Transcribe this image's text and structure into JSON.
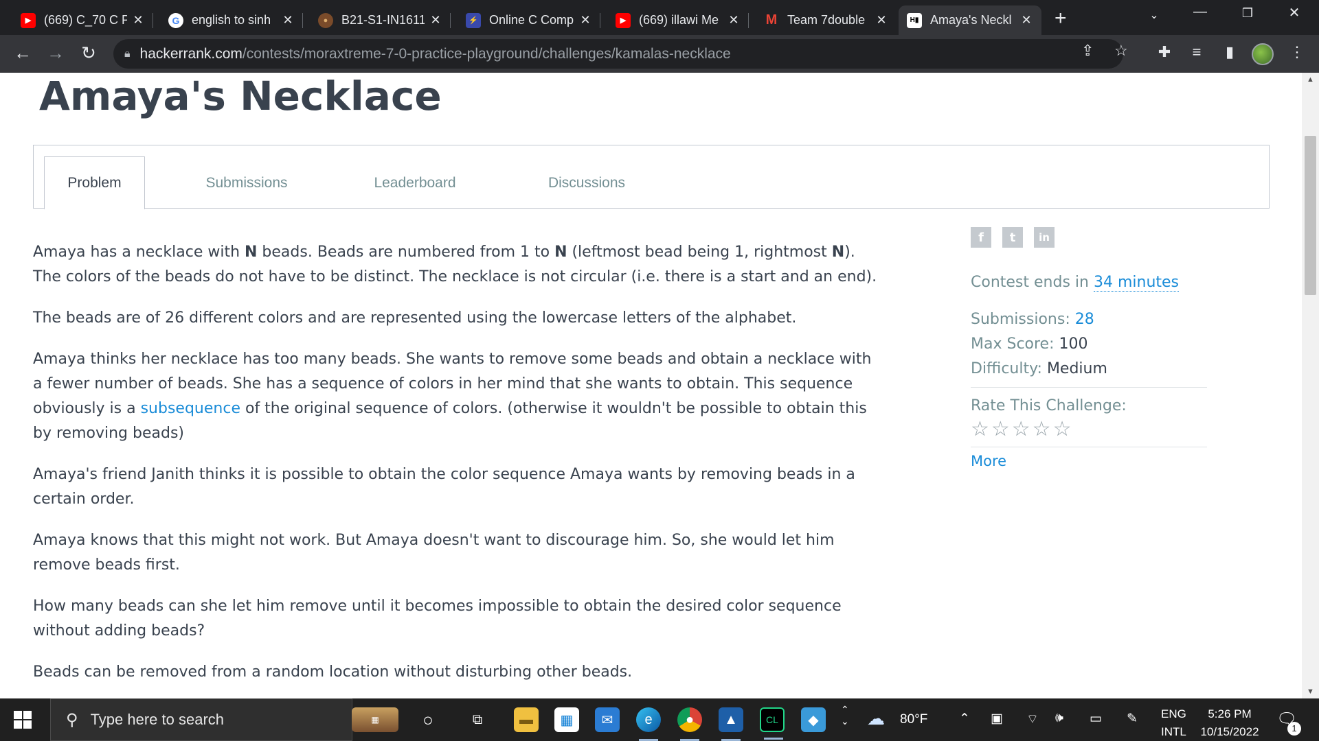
{
  "browser": {
    "tabs": [
      {
        "title": "(669) C_70 C Pr",
        "favicon": "youtube-icon",
        "color": "#ff0000",
        "glyph": "▶"
      },
      {
        "title": "english to sinh",
        "favicon": "google-icon",
        "color": "#ffffff",
        "glyph": "G"
      },
      {
        "title": "B21-S1-IN1611",
        "favicon": "moodle-icon",
        "color": "#7a4b2a",
        "glyph": "●"
      },
      {
        "title": "Online C Comp",
        "favicon": "bolt-icon",
        "color": "#3949ab",
        "glyph": "⚡"
      },
      {
        "title": "(669) illawi Me",
        "favicon": "youtube-icon",
        "color": "#ff0000",
        "glyph": "▶"
      },
      {
        "title": "Team 7double",
        "favicon": "gmail-icon",
        "color": "#202124",
        "glyph": "M"
      },
      {
        "title": "Amaya's Neckl",
        "favicon": "hackerrank-icon",
        "color": "#ffffff",
        "glyph": "H"
      }
    ],
    "url_domain": "hackerrank.com",
    "url_path": "/contests/moraxtreme-7-0-practice-playground/challenges/kamalas-necklace"
  },
  "page": {
    "title": "Amaya's Necklace",
    "tabs": [
      "Problem",
      "Submissions",
      "Leaderboard",
      "Discussions"
    ],
    "description": {
      "p1_a": "Amaya has a necklace with ",
      "n": "N",
      "p1_b": " beads. Beads are numbered from 1 to ",
      "p1_c": " (leftmost bead being 1, rightmost ",
      "p1_d": "). The colors of the beads do not have to be distinct. The necklace is not circular (i.e. there is a start and an end).",
      "p2": "The beads are of 26 different colors and are represented using the lowercase letters of the alphabet.",
      "p3_a": "Amaya thinks her necklace has too many beads. She wants to remove some beads and obtain a necklace with a fewer number of beads. She has a sequence of colors in her mind that she wants to obtain. This sequence obviously is a ",
      "p3_link": "subsequence",
      "p3_b": " of the original sequence of colors. (otherwise it wouldn't be possible to obtain this by removing beads)",
      "p4": "Amaya's friend Janith thinks it is possible to obtain the color sequence Amaya wants by removing beads in a certain order.",
      "p5": "Amaya knows that this might not work. But Amaya doesn't want to discourage him. So, she would let him remove beads first.",
      "p6": "How many beads can she let him remove until it becomes impossible to obtain the desired color sequence without adding beads?",
      "p7": "Beads can be removed from a random location without disturbing other beads."
    },
    "sidebar": {
      "share": [
        "f",
        "t",
        "in"
      ],
      "contest_prefix": "Contest ends in ",
      "contest_time": "34 minutes",
      "submissions_label": "Submissions:",
      "submissions_value": "28",
      "max_score_label": "Max Score:",
      "max_score_value": "100",
      "difficulty_label": "Difficulty:",
      "difficulty_value": "Medium",
      "rate_label": "Rate This Challenge:",
      "stars": "☆☆☆☆☆",
      "more": "More"
    }
  },
  "taskbar": {
    "search_placeholder": "Type here to search",
    "weather": "80°F",
    "lang_top": "ENG",
    "lang_bottom": "INTL",
    "time": "5:26 PM",
    "date": "10/15/2022",
    "notification_count": "1"
  }
}
